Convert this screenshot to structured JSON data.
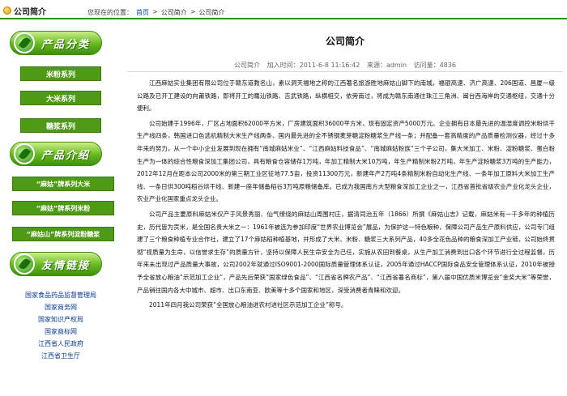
{
  "header": {
    "brand_title": "公司简介",
    "breadcrumb_prefix": "您现在的位置：",
    "breadcrumb_home": "首页",
    "sep1": ">",
    "breadcrumb_section": "公司简介",
    "sep2": ">",
    "breadcrumb_current": "公司简介"
  },
  "sidebar": {
    "products_title": "产品分类",
    "products": [
      "米粉系列",
      "大米系列",
      "糖浆系列"
    ],
    "intro_title": "产品介绍",
    "intro_items": [
      "“麻姑”牌系列大米",
      "“麻姑”牌系列米粉",
      "“麻姑山”牌系列淀粉糖浆"
    ],
    "links_title": "友情链接",
    "links": [
      "国家食品药品监督管理局",
      "国家商务网",
      "国家知识产权局",
      "国家商标网",
      "江西省人民政府",
      "江西省卫生厅"
    ]
  },
  "article": {
    "title": "公司简介",
    "meta": {
      "section": "公司简介",
      "date": "加入时间：2011-6-8 11:16:42",
      "source": "来源：admin",
      "views": "访问量：4836"
    },
    "paragraphs": [
      "江西麻姑实业集团有限公司位于赣东道教名山，素以洞天福地之称的江西著名旅游胜地麻姑山脚下的南城，福银高速、济广高速、206国道、昌厦一级公路及已开工建设的向莆铁路，即将开工的鹰汕铁路、吉武铁路，纵横相交，依旁南过，将成为赣东南通往珠江三角洲、闽台西海岸的交通枢纽，交通十分便利。",
      "公司始建于1996年，厂区占地面积62000平方米，厂房建筑面积36000平方米，现有固定资产5000万元。企业拥有日本最先进的温湿度调控米粉烘干生产线四条，韩国进口色选机精制大米生产线两条、国内最先进的全不锈钢麦芽糖淀粉糖浆生产线一条；并配备一套高精度的产品质量检测仪器，经过十多年来的努力，从一个中小企业发展到现在拥有“南城麻姑米业”、“江西麻姑料技食品”、“南城麻姑粉族”三个子公司，集大米加工、米粉、淀粉糖浆、蛋白粉生产为一体的综合性粮食深加工集团公司，具有粮食仓容储存1万吨，年加工精制大米10万吨，年生产精制米粉2万吨，年生产淀粉糖浆3万吨的生产能力，2012年12月在距本公司2000米的第三期工业区征地77.5亩，投资11300万元，新建年产2万吨4条精制米粉自动化生产线、一条年加工原料大米加工生产线、一条日供300吨稻谷烘干线、新建一座年储备稻谷3万吨原粮储备库。已成为我国南方大型粮食深加工企业之一，江西省首批省级农业产业化龙头企业，农业产业化国家重点龙头企业。",
      "公司产品主要原料麻姑米仅产于风景秀丽、仙气缭绕的麻姑山周围村庄，据清同治五年（1866）所撰《麻姑山志》记载，麻姑米有一千多年的种植历史，历代皆为贡米，是全国名贵大米之一：1961年被选为参加印度“世界农业博览会”展品，为保护这一特色粮种，保障公司产品生产原料供应，公司专门组建了三个粮食种植专业合作社，建立了17个麻姑稻种植基地，并形成了大米、米粉、糖浆三大系列产品，40多全花色品种的粮食深加工产业链，公司始终贯彻“视质量为生命，以信誉求生存”的质量方针，坚持以保障人民生命安全为己任，实施从农田到餐桌，从生产加工消费到出口各个环节进行全过程监督，历年来未出现过产品质量大事故，公司2002年就通过ISO9001-2000国际质量管理体系认证，2005年通过HACCP国际食品安全管理体系认证，2010年被授予全省放心粮油“示范加工企业”，产品先后荣获“国家绿色食品”、“江西省名牌农产品”、“江西省著名商标”，第八届中国优质米博览会“金奖大米”等荣誉，产品销往国内各大中城市、超市、出口东南亚、欧美等十多个国家和地区，深受消费者青睐和欢迎。",
      "2011年四月我公司荣获“全国放心粮油进农村进社区示范加工企业”称号。"
    ]
  }
}
